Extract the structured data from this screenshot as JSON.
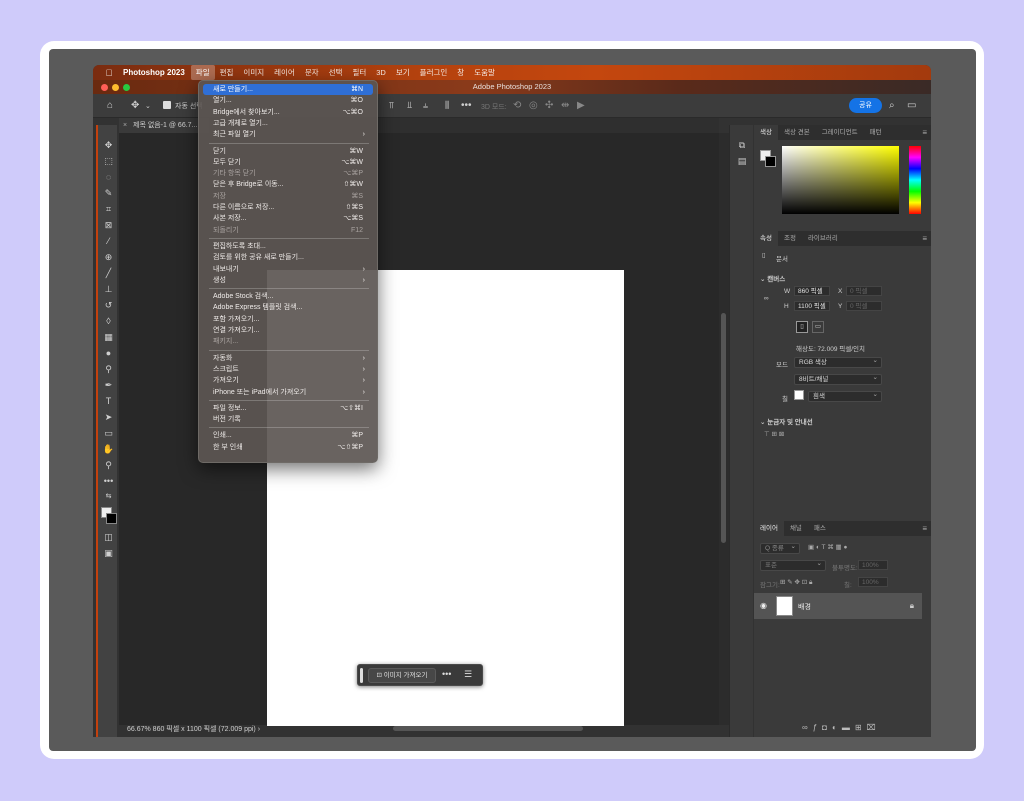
{
  "menubar": {
    "app": "Photoshop 2023",
    "items": [
      "파일",
      "편집",
      "이미지",
      "레이어",
      "문자",
      "선택",
      "필터",
      "3D",
      "보기",
      "플러그인",
      "창",
      "도움말"
    ]
  },
  "window": {
    "title": "Adobe Photoshop 2023"
  },
  "optionbar": {
    "auto_select": "자동 선택",
    "share": "공유"
  },
  "document": {
    "tab": "제목 없음-1 @ 66.7..."
  },
  "status": {
    "text": "66.67%   860 픽셀 x 1100 픽셀 (72.009 ppi)"
  },
  "contextbar": {
    "button": "이미지 가져오기"
  },
  "file_menu": {
    "items": [
      {
        "label": "새로 만들기...",
        "shortcut": "⌘N",
        "state": "highlight"
      },
      {
        "label": "열기...",
        "shortcut": "⌘O"
      },
      {
        "label": "Bridge에서 찾아보기...",
        "shortcut": "⌥⌘O"
      },
      {
        "label": "고급 개체로 열기...",
        "shortcut": ""
      },
      {
        "label": "최근 파일 열기",
        "shortcut": "",
        "submenu": true
      },
      {
        "sep": true
      },
      {
        "label": "닫기",
        "shortcut": "⌘W"
      },
      {
        "label": "모두 닫기",
        "shortcut": "⌥⌘W"
      },
      {
        "label": "기타 항목 닫기",
        "shortcut": "⌥⌘P",
        "state": "disabled"
      },
      {
        "label": "닫은 후 Bridge로 이동...",
        "shortcut": "⇧⌘W"
      },
      {
        "label": "저장",
        "shortcut": "⌘S",
        "state": "disabled"
      },
      {
        "label": "다른 이름으로 저장...",
        "shortcut": "⇧⌘S"
      },
      {
        "label": "사본 저장...",
        "shortcut": "⌥⌘S"
      },
      {
        "label": "되돌리기",
        "shortcut": "F12",
        "state": "disabled"
      },
      {
        "sep": true
      },
      {
        "label": "편집하도록 초대...",
        "shortcut": ""
      },
      {
        "label": "검토를 위한 공유 새로 만들기...",
        "shortcut": ""
      },
      {
        "label": "내보내기",
        "shortcut": "",
        "submenu": true
      },
      {
        "label": "생성",
        "shortcut": "",
        "submenu": true
      },
      {
        "sep": true
      },
      {
        "label": "Adobe Stock 검색...",
        "shortcut": ""
      },
      {
        "label": "Adobe Express 템플릿 검색...",
        "shortcut": ""
      },
      {
        "label": "포함 가져오기...",
        "shortcut": ""
      },
      {
        "label": "연결 가져오기...",
        "shortcut": ""
      },
      {
        "label": "패키지...",
        "shortcut": "",
        "state": "disabled"
      },
      {
        "sep": true
      },
      {
        "label": "자동화",
        "shortcut": "",
        "submenu": true
      },
      {
        "label": "스크립트",
        "shortcut": "",
        "submenu": true
      },
      {
        "label": "가져오기",
        "shortcut": "",
        "submenu": true
      },
      {
        "label": "iPhone 또는 iPad에서 가져오기",
        "shortcut": "",
        "submenu": true
      },
      {
        "sep": true
      },
      {
        "label": "파일 정보...",
        "shortcut": "⌥⇧⌘I"
      },
      {
        "label": "버전 기록",
        "shortcut": ""
      },
      {
        "sep": true
      },
      {
        "label": "인쇄...",
        "shortcut": "⌘P"
      },
      {
        "label": "한 부 인쇄",
        "shortcut": "⌥⇧⌘P"
      }
    ]
  },
  "color_panel": {
    "tabs": [
      "색상",
      "색상 견본",
      "그레이디언트",
      "패턴"
    ]
  },
  "properties_panel": {
    "tabs": [
      "속성",
      "조정",
      "라이브러리"
    ],
    "doc_label": "문서",
    "canvas_title": "캔버스",
    "w_label": "W",
    "w_value": "860 픽셀",
    "h_label": "H",
    "h_value": "1100 픽셀",
    "x_label": "X",
    "x_placeholder": "0 픽셀",
    "y_label": "Y",
    "y_placeholder": "0 픽셀",
    "resolution": "해상도: 72.009 픽셀/인치",
    "mode_label": "모드",
    "mode_value": "RGB 색상",
    "bit_value": "8비트/채널",
    "fill_label": "칠",
    "fill_value": "흰색",
    "rulers_title": "눈금자 및 안내선"
  },
  "layers_panel": {
    "tabs": [
      "레이어",
      "채널",
      "패스"
    ],
    "search_placeholder": "Q 종류",
    "blend_mode": "표준",
    "opacity_label": "불투명도:",
    "opacity_value": "100%",
    "lock_label": "잠그기:",
    "fill_label": "칠:",
    "fill_value": "100%",
    "layer_name": "배경"
  }
}
